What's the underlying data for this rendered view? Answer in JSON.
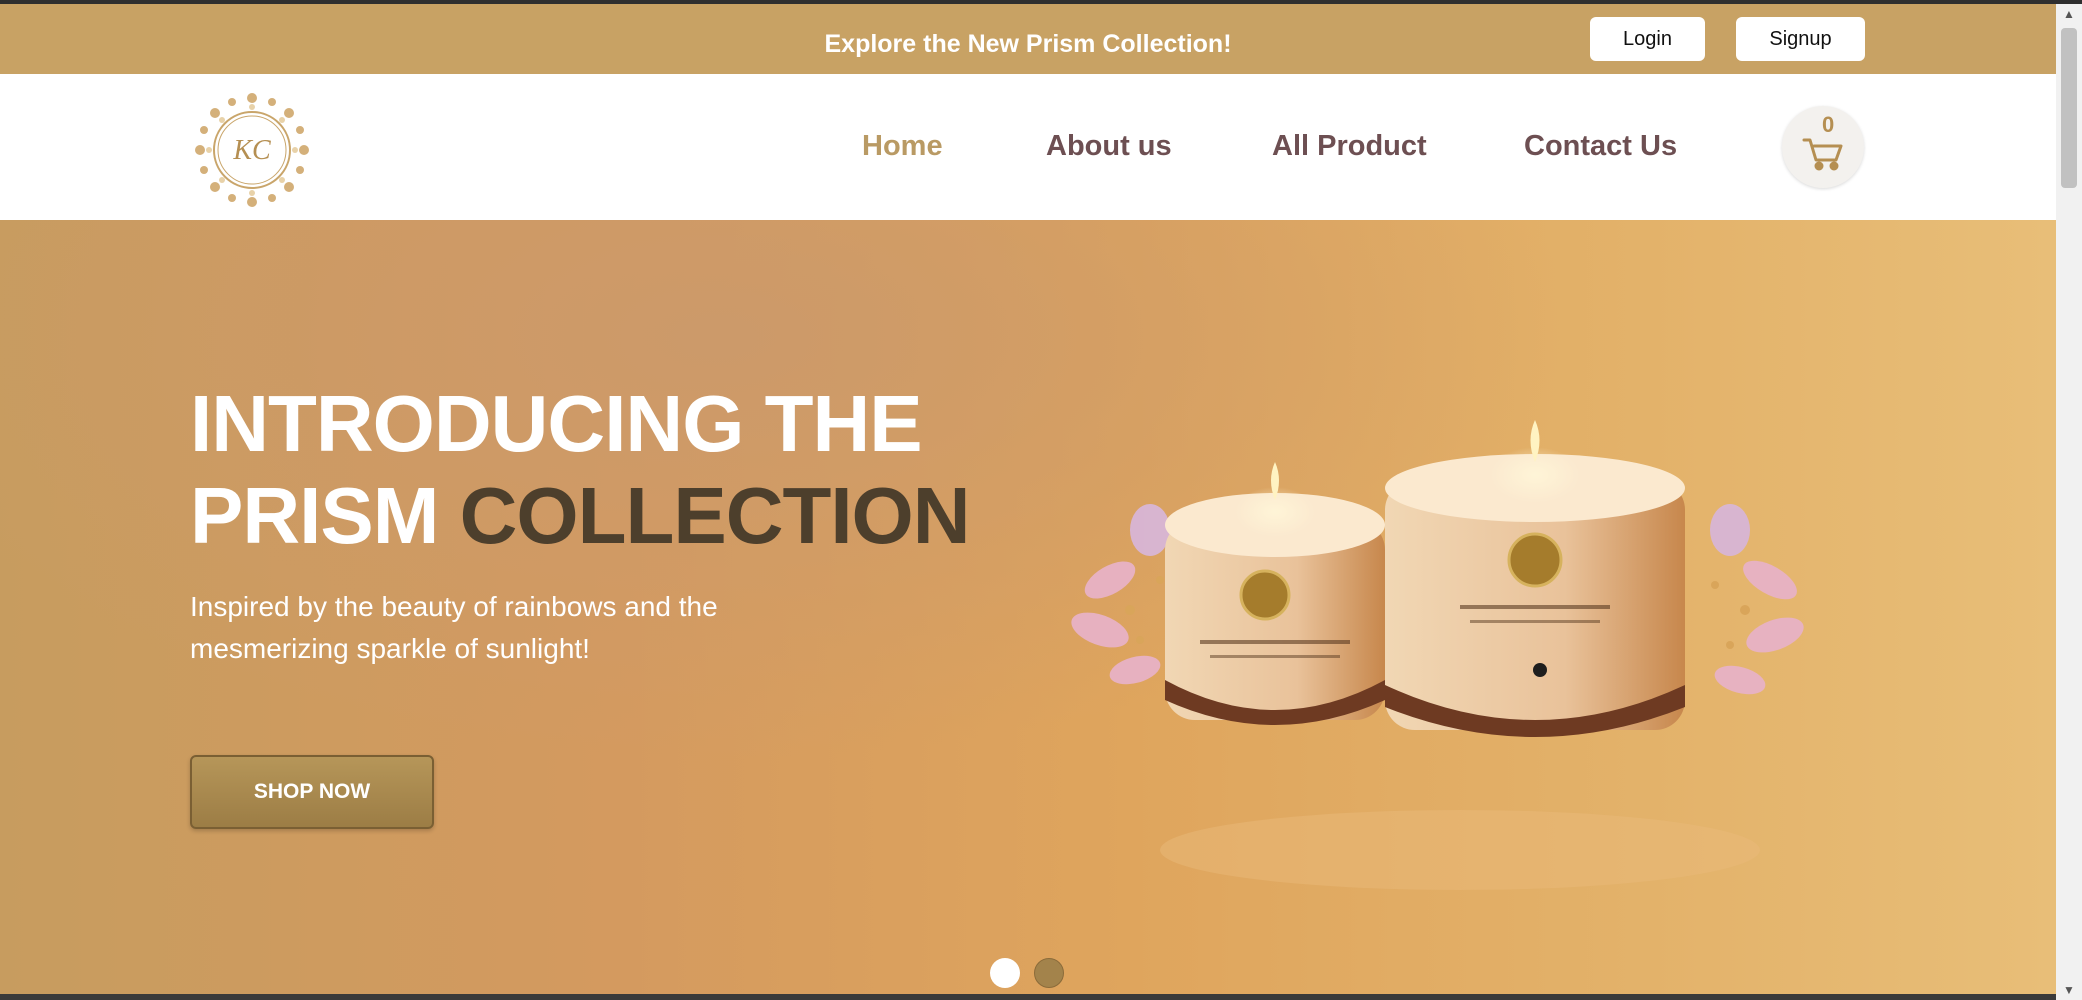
{
  "announcement": {
    "text": "Explore the New Prism Collection!",
    "login_label": "Login",
    "signup_label": "Signup"
  },
  "navbar": {
    "logo_text": "KC",
    "links": [
      {
        "label": "Home",
        "active": true
      },
      {
        "label": "About us",
        "active": false
      },
      {
        "label": "All Product",
        "active": false
      },
      {
        "label": "Contact Us",
        "active": false
      }
    ],
    "cart_count": "0",
    "cart_icon": "cart-icon"
  },
  "hero": {
    "title_line1": "INTRODUCING THE",
    "title_line2_light": "PRISM",
    "title_line2_dark": "COLLECTION",
    "subtitle": "Inspired by the beauty of rainbows and the mesmerizing sparkle of sunlight!",
    "cta_label": "SHOP NOW",
    "slides": 2,
    "active_slide": 1
  },
  "colors": {
    "brand_gold": "#c8a264",
    "nav_text": "#6d4f52",
    "nav_active": "#b99a64",
    "hero_dark_text": "#4d3f2c"
  }
}
